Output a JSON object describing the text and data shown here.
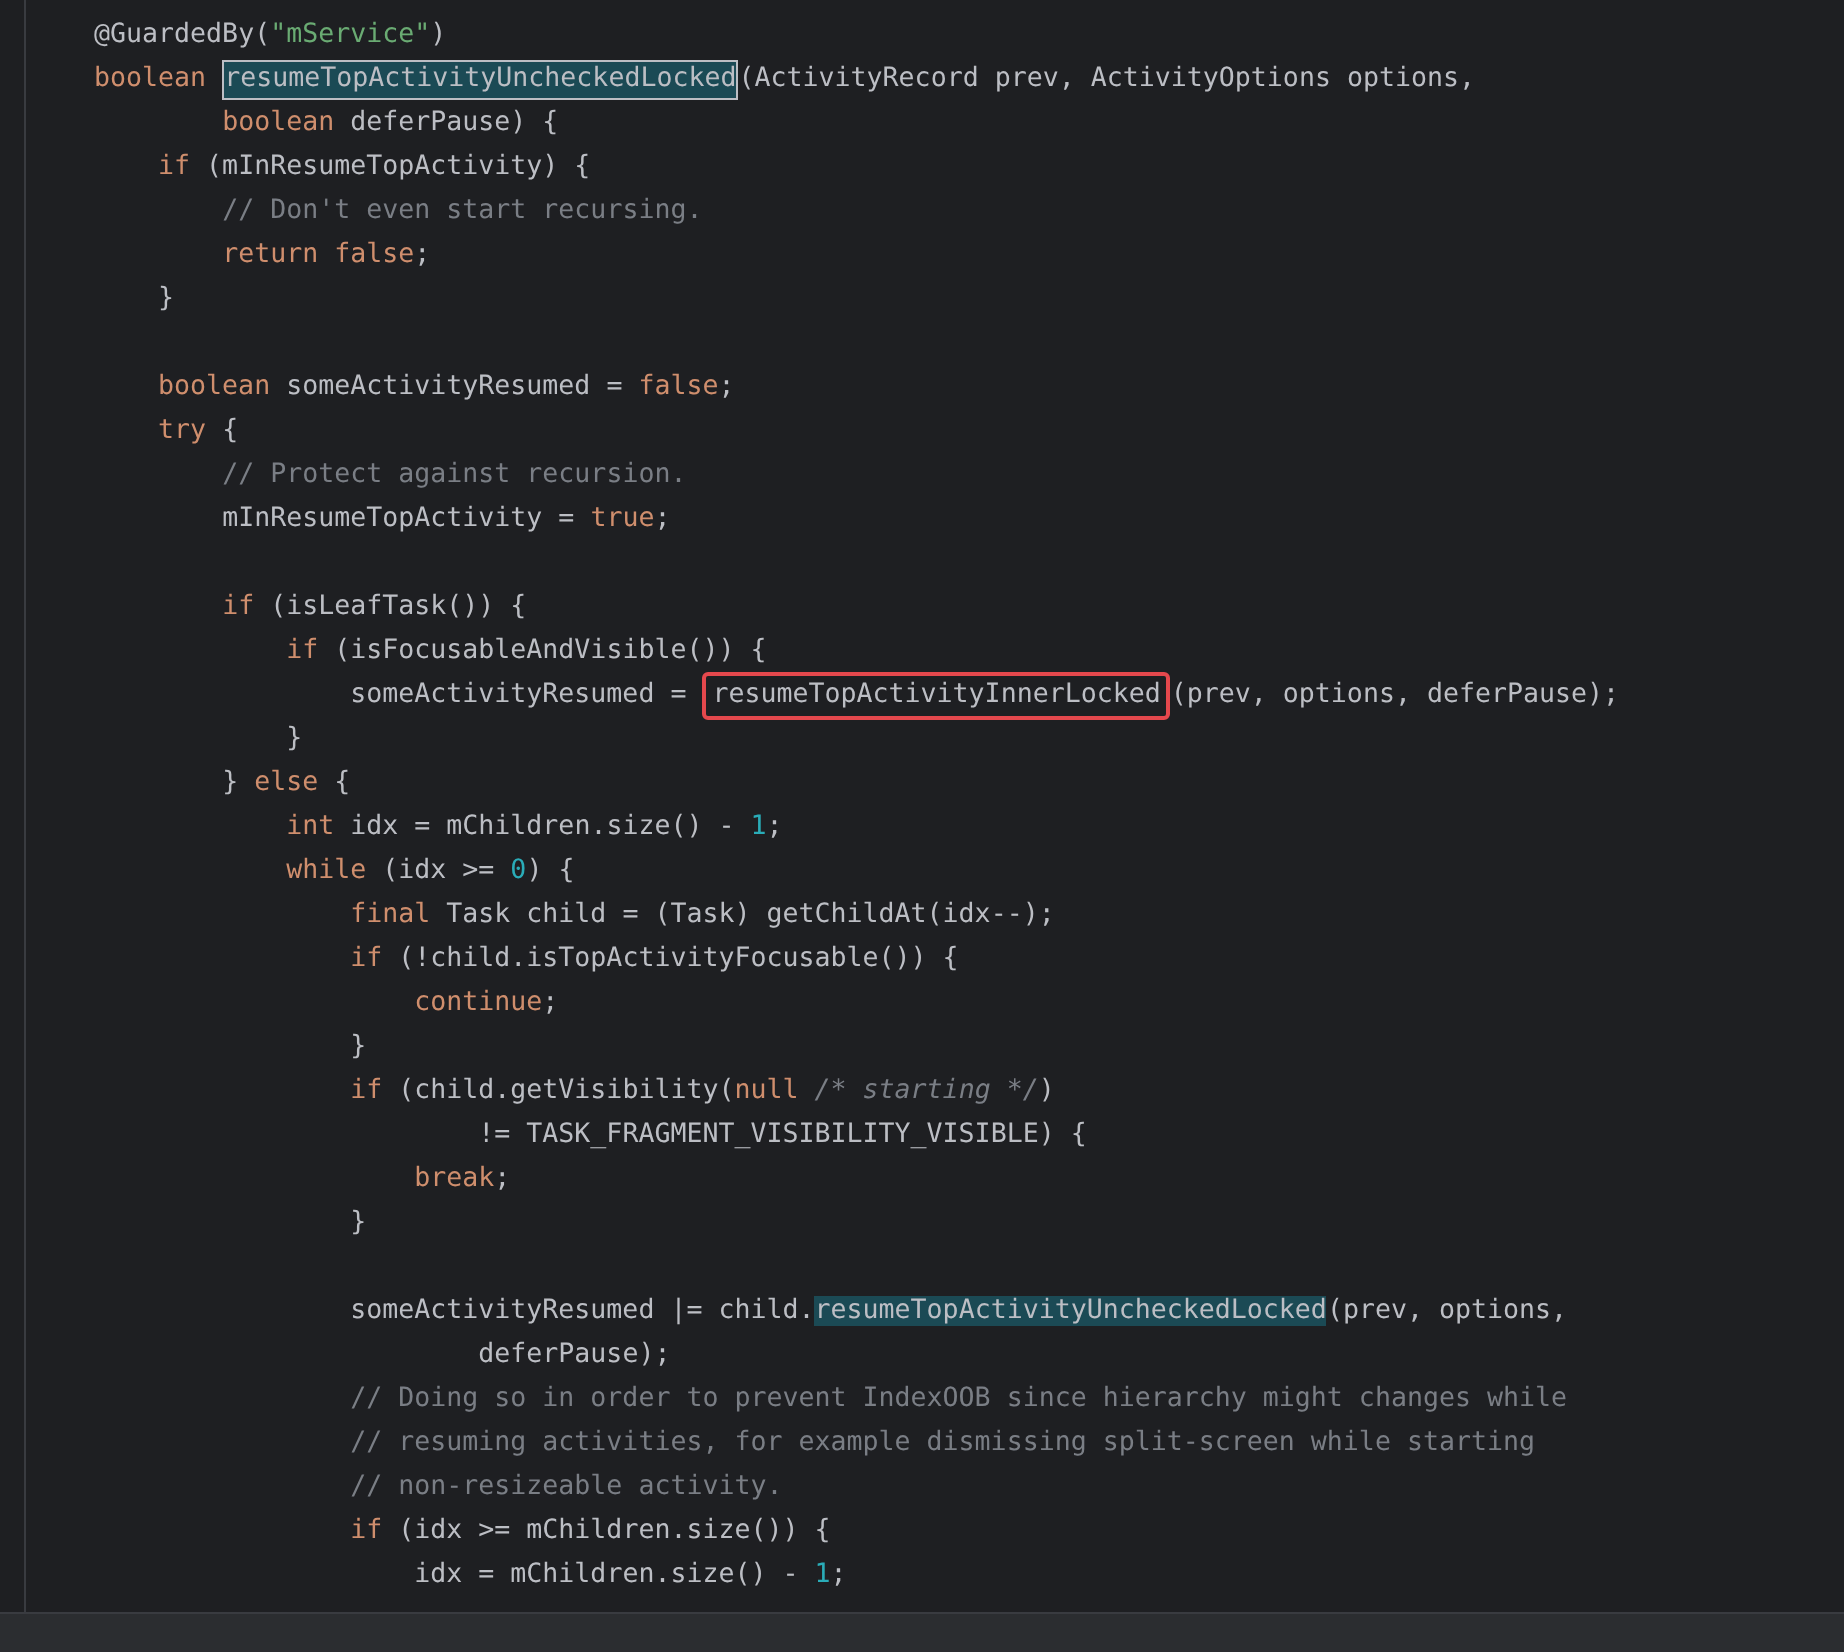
{
  "editor": {
    "lines": [
      {
        "kind": "code",
        "tokens": [
          {
            "kind": "plain",
            "text": "    @GuardedBy("
          },
          {
            "kind": "string",
            "text": "\"mService\""
          },
          {
            "kind": "plain",
            "text": ")"
          }
        ]
      },
      {
        "kind": "code",
        "tokens": [
          {
            "kind": "keyword",
            "text": "    boolean "
          },
          {
            "kind": "selected",
            "text": "resumeTopActivityUncheckedLocked"
          },
          {
            "kind": "plain",
            "text": "(ActivityRecord prev, ActivityOptions options,"
          }
        ]
      },
      {
        "kind": "code",
        "tokens": [
          {
            "kind": "keyword",
            "text": "            boolean"
          },
          {
            "kind": "plain",
            "text": " deferPause) {"
          }
        ]
      },
      {
        "kind": "code",
        "tokens": [
          {
            "kind": "keyword",
            "text": "        if"
          },
          {
            "kind": "plain",
            "text": " (mInResumeTopActivity) {"
          }
        ]
      },
      {
        "kind": "code",
        "tokens": [
          {
            "kind": "comment",
            "text": "            // Don't even start recursing."
          }
        ]
      },
      {
        "kind": "code",
        "tokens": [
          {
            "kind": "keyword",
            "text": "            return false"
          },
          {
            "kind": "plain",
            "text": ";"
          }
        ]
      },
      {
        "kind": "code",
        "tokens": [
          {
            "kind": "plain",
            "text": "        }"
          }
        ]
      },
      {
        "kind": "blank"
      },
      {
        "kind": "code",
        "tokens": [
          {
            "kind": "keyword",
            "text": "        boolean"
          },
          {
            "kind": "plain",
            "text": " someActivityResumed = "
          },
          {
            "kind": "keyword",
            "text": "false"
          },
          {
            "kind": "plain",
            "text": ";"
          }
        ]
      },
      {
        "kind": "code",
        "tokens": [
          {
            "kind": "keyword",
            "text": "        try"
          },
          {
            "kind": "plain",
            "text": " {"
          }
        ]
      },
      {
        "kind": "code",
        "tokens": [
          {
            "kind": "comment",
            "text": "            // Protect against recursion."
          }
        ]
      },
      {
        "kind": "code",
        "tokens": [
          {
            "kind": "plain",
            "text": "            mInResumeTopActivity = "
          },
          {
            "kind": "keyword",
            "text": "true"
          },
          {
            "kind": "plain",
            "text": ";"
          }
        ]
      },
      {
        "kind": "blank"
      },
      {
        "kind": "code",
        "tokens": [
          {
            "kind": "keyword",
            "text": "            if"
          },
          {
            "kind": "plain",
            "text": " (isLeafTask()) {"
          }
        ]
      },
      {
        "kind": "code",
        "tokens": [
          {
            "kind": "keyword",
            "text": "                if"
          },
          {
            "kind": "plain",
            "text": " (isFocusableAndVisible()) {"
          }
        ]
      },
      {
        "kind": "code",
        "tokens": [
          {
            "kind": "plain",
            "text": "                    someActivityResumed = "
          },
          {
            "kind": "boxed",
            "text": "resumeTopActivityInnerLocked"
          },
          {
            "kind": "plain",
            "text": "(prev, options, deferPause);"
          }
        ]
      },
      {
        "kind": "code",
        "tokens": [
          {
            "kind": "plain",
            "text": "                }"
          }
        ]
      },
      {
        "kind": "code",
        "tokens": [
          {
            "kind": "plain",
            "text": "            } "
          },
          {
            "kind": "keyword",
            "text": "else"
          },
          {
            "kind": "plain",
            "text": " {"
          }
        ]
      },
      {
        "kind": "code",
        "tokens": [
          {
            "kind": "keyword",
            "text": "                int"
          },
          {
            "kind": "plain",
            "text": " idx = mChildren.size() - "
          },
          {
            "kind": "number",
            "text": "1"
          },
          {
            "kind": "plain",
            "text": ";"
          }
        ]
      },
      {
        "kind": "code",
        "tokens": [
          {
            "kind": "keyword",
            "text": "                while"
          },
          {
            "kind": "plain",
            "text": " (idx >= "
          },
          {
            "kind": "number",
            "text": "0"
          },
          {
            "kind": "plain",
            "text": ") {"
          }
        ]
      },
      {
        "kind": "code",
        "tokens": [
          {
            "kind": "keyword",
            "text": "                    final"
          },
          {
            "kind": "plain",
            "text": " Task child = (Task) getChildAt(idx--);"
          }
        ]
      },
      {
        "kind": "code",
        "tokens": [
          {
            "kind": "keyword",
            "text": "                    if"
          },
          {
            "kind": "plain",
            "text": " (!child.isTopActivityFocusable()) {"
          }
        ]
      },
      {
        "kind": "code",
        "tokens": [
          {
            "kind": "keyword",
            "text": "                        continue"
          },
          {
            "kind": "plain",
            "text": ";"
          }
        ]
      },
      {
        "kind": "code",
        "tokens": [
          {
            "kind": "plain",
            "text": "                    }"
          }
        ]
      },
      {
        "kind": "code",
        "tokens": [
          {
            "kind": "keyword",
            "text": "                    if"
          },
          {
            "kind": "plain",
            "text": " (child.getVisibility("
          },
          {
            "kind": "keyword",
            "text": "null "
          },
          {
            "kind": "inline_comment",
            "text": "/* starting */"
          },
          {
            "kind": "plain",
            "text": ")"
          }
        ]
      },
      {
        "kind": "code",
        "tokens": [
          {
            "kind": "plain",
            "text": "                            != TASK_FRAGMENT_VISIBILITY_VISIBLE) {"
          }
        ]
      },
      {
        "kind": "code",
        "tokens": [
          {
            "kind": "keyword",
            "text": "                        break"
          },
          {
            "kind": "plain",
            "text": ";"
          }
        ]
      },
      {
        "kind": "code",
        "tokens": [
          {
            "kind": "plain",
            "text": "                    }"
          }
        ]
      },
      {
        "kind": "blank"
      },
      {
        "kind": "code",
        "tokens": [
          {
            "kind": "plain",
            "text": "                    someActivityResumed |= child."
          },
          {
            "kind": "usage",
            "text": "resumeTopActivityUncheckedLocked"
          },
          {
            "kind": "plain",
            "text": "(prev, options,"
          }
        ]
      },
      {
        "kind": "code",
        "tokens": [
          {
            "kind": "plain",
            "text": "                            deferPause);"
          }
        ]
      },
      {
        "kind": "code",
        "tokens": [
          {
            "kind": "comment",
            "text": "                    // Doing so in order to prevent IndexOOB since hierarchy might changes while"
          }
        ]
      },
      {
        "kind": "code",
        "tokens": [
          {
            "kind": "comment",
            "text": "                    // resuming activities, for example dismissing split-screen while starting"
          }
        ]
      },
      {
        "kind": "code",
        "tokens": [
          {
            "kind": "comment",
            "text": "                    // non-resizeable activity."
          }
        ]
      },
      {
        "kind": "code",
        "tokens": [
          {
            "kind": "keyword",
            "text": "                    if"
          },
          {
            "kind": "plain",
            "text": " (idx >= mChildren.size()) {"
          }
        ]
      },
      {
        "kind": "code",
        "tokens": [
          {
            "kind": "plain",
            "text": "                        idx = mChildren.size() - "
          },
          {
            "kind": "number",
            "text": "1"
          },
          {
            "kind": "plain",
            "text": ";"
          }
        ]
      }
    ]
  }
}
